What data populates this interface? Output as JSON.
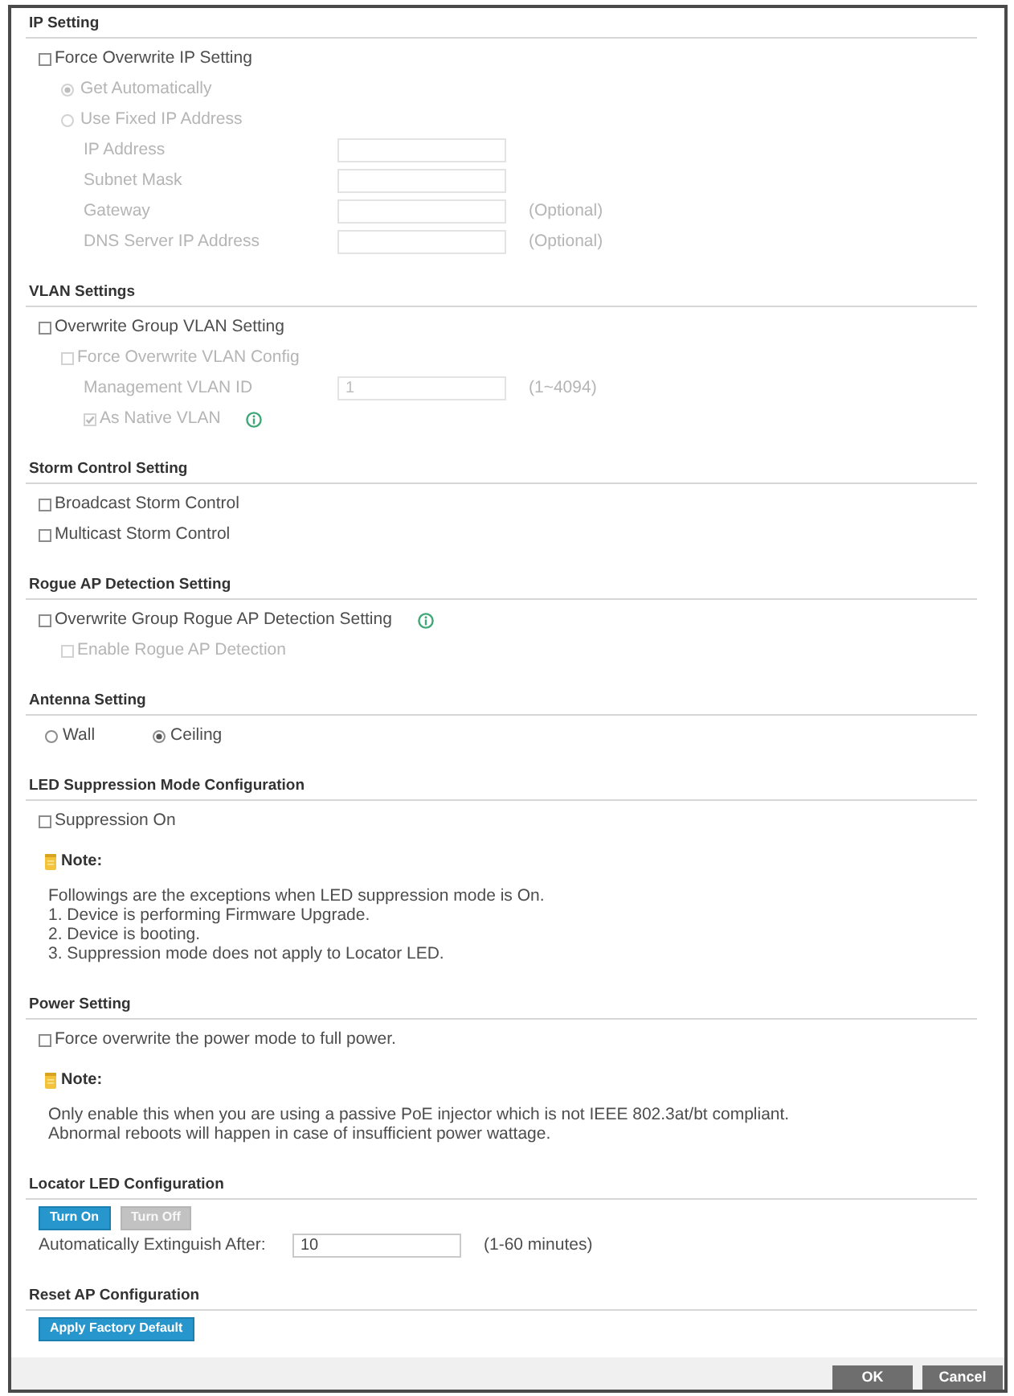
{
  "sections": [
    {
      "title": "IP Setting",
      "items": [
        {
          "kind": "checkbox",
          "label": "Force Overwrite IP Setting",
          "checked": false,
          "disabled": false,
          "children": [
            {
              "kind": "radio",
              "label": "Get Automatically",
              "selected": true,
              "disabled": true
            },
            {
              "kind": "radio",
              "label": "Use Fixed IP Address",
              "selected": false,
              "disabled": true,
              "children": [
                {
                  "kind": "field",
                  "label": "IP Address",
                  "disabled": true
                },
                {
                  "kind": "field",
                  "label": "Subnet Mask",
                  "disabled": true
                },
                {
                  "kind": "field",
                  "label": "Gateway",
                  "hint": "(Optional)",
                  "disabled": true
                },
                {
                  "kind": "field",
                  "label": "DNS Server IP Address",
                  "hint": "(Optional)",
                  "disabled": true
                }
              ]
            }
          ]
        }
      ]
    },
    {
      "title": "VLAN Settings",
      "items": [
        {
          "kind": "checkbox",
          "label": "Overwrite Group VLAN Setting",
          "checked": false,
          "disabled": false,
          "children": [
            {
              "kind": "checkbox",
              "label": "Force Overwrite VLAN Config",
              "checked": false,
              "disabled": true,
              "children": [
                {
                  "kind": "field",
                  "label": "Management VLAN ID",
                  "value": "1",
                  "hint": "(1~4094)",
                  "disabled": true
                },
                {
                  "kind": "checkbox",
                  "label": "As Native VLAN",
                  "checked": true,
                  "disabled": true,
                  "info": true
                }
              ]
            }
          ]
        }
      ]
    },
    {
      "title": "Storm Control Setting",
      "items": [
        {
          "kind": "checkbox",
          "label": "Broadcast Storm Control",
          "checked": false,
          "disabled": false
        },
        {
          "kind": "checkbox",
          "label": "Multicast Storm Control",
          "checked": false,
          "disabled": false
        }
      ]
    },
    {
      "title": "Rogue AP Detection Setting",
      "items": [
        {
          "kind": "checkbox",
          "label": "Overwrite Group Rogue AP Detection Setting",
          "checked": false,
          "disabled": false,
          "info": true,
          "children": [
            {
              "kind": "checkbox",
              "label": "Enable Rogue AP Detection",
              "checked": false,
              "disabled": true
            }
          ]
        }
      ]
    },
    {
      "title": "Antenna Setting",
      "items": [
        {
          "kind": "radio_group",
          "options": [
            {
              "label": "Wall",
              "selected": false
            },
            {
              "label": "Ceiling",
              "selected": true
            }
          ]
        }
      ]
    },
    {
      "title": "LED Suppression Mode Configuration",
      "items": [
        {
          "kind": "checkbox",
          "label": "Suppression On",
          "checked": false,
          "disabled": false
        },
        {
          "kind": "note",
          "title": "Note:",
          "lines": [
            "Followings are the exceptions when LED suppression mode is On.",
            "1. Device is performing Firmware Upgrade.",
            "2. Device is booting.",
            "3. Suppression mode does not apply to Locator LED."
          ]
        }
      ]
    },
    {
      "title": "Power Setting",
      "items": [
        {
          "kind": "checkbox",
          "label": "Force overwrite the power mode to full power.",
          "checked": false,
          "disabled": false
        },
        {
          "kind": "note",
          "title": "Note:",
          "lines": [
            "Only enable this when you are using a passive PoE injector which is not IEEE 802.3at/bt compliant.",
            "Abnormal reboots will happen in case of insufficient power wattage."
          ]
        }
      ]
    },
    {
      "title": "Locator LED Configuration",
      "items": [
        {
          "kind": "buttons",
          "buttons": [
            {
              "label": "Turn On",
              "disabled": false
            },
            {
              "label": "Turn Off",
              "disabled": true
            }
          ]
        },
        {
          "kind": "field",
          "label": "Automatically Extinguish After:",
          "value": "10",
          "hint": "(1-60 minutes)",
          "disabled": false
        }
      ]
    },
    {
      "title": "Reset AP Configuration",
      "items": [
        {
          "kind": "buttons",
          "buttons": [
            {
              "label": "Apply Factory Default",
              "disabled": false
            }
          ]
        }
      ]
    }
  ],
  "footer": {
    "buttons": [
      {
        "label": "OK"
      },
      {
        "label": "Cancel"
      }
    ]
  }
}
